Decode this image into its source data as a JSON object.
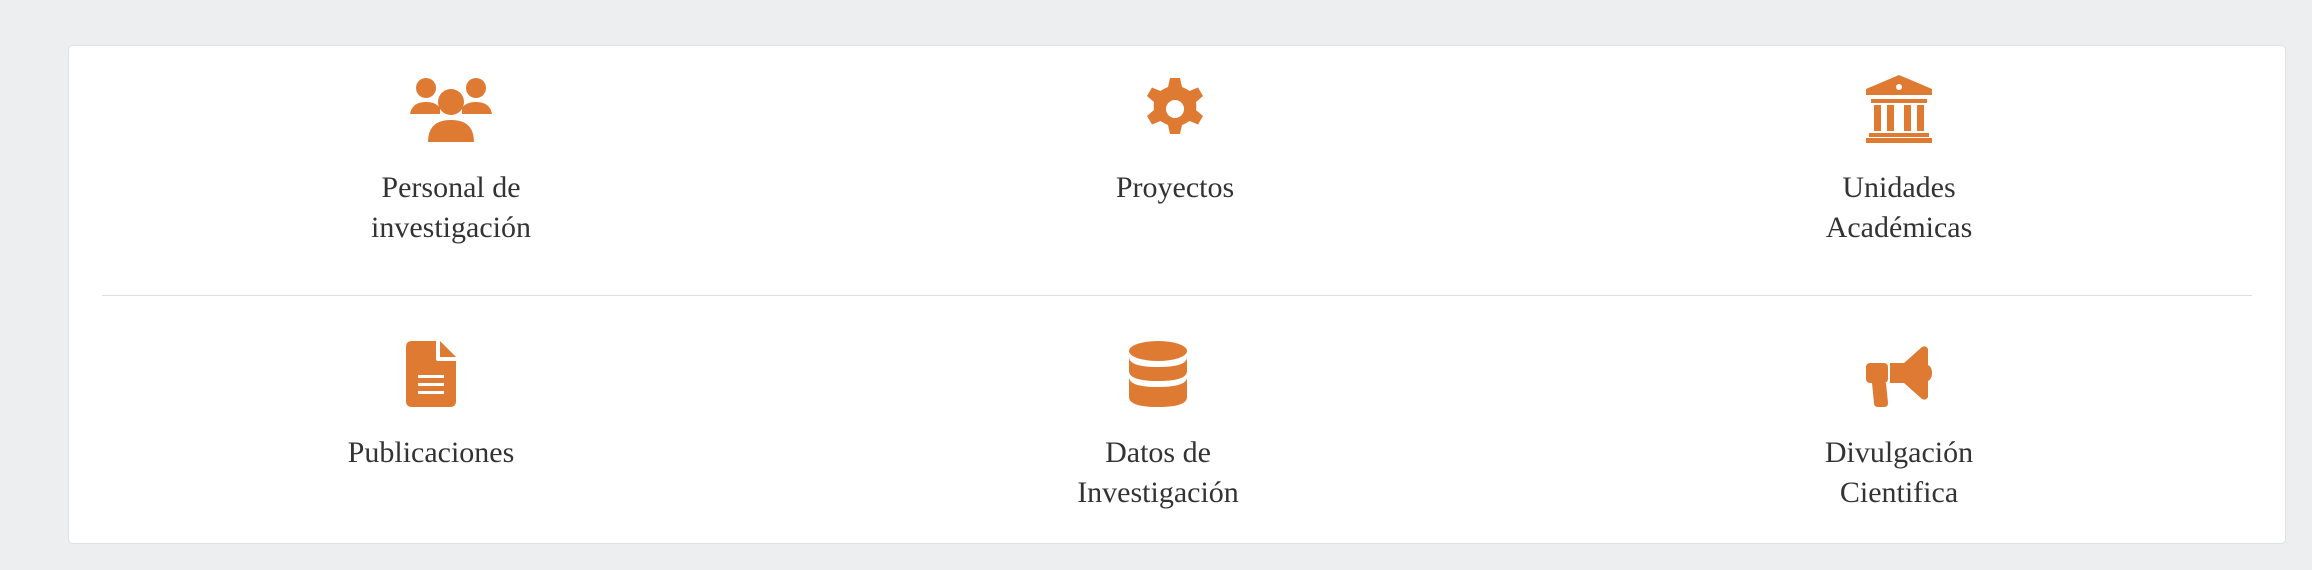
{
  "accent_color": "#df7a33",
  "tiles": [
    {
      "label": "Personal de investigación",
      "icon": "users-icon"
    },
    {
      "label": "Proyectos",
      "icon": "gear-icon"
    },
    {
      "label": "Unidades Académicas",
      "icon": "institution-icon"
    },
    {
      "label": "Publicaciones",
      "icon": "file-text-icon"
    },
    {
      "label": "Datos de Investigación",
      "icon": "database-icon"
    },
    {
      "label": "Divulgación Cientifica",
      "icon": "bullhorn-icon"
    }
  ]
}
